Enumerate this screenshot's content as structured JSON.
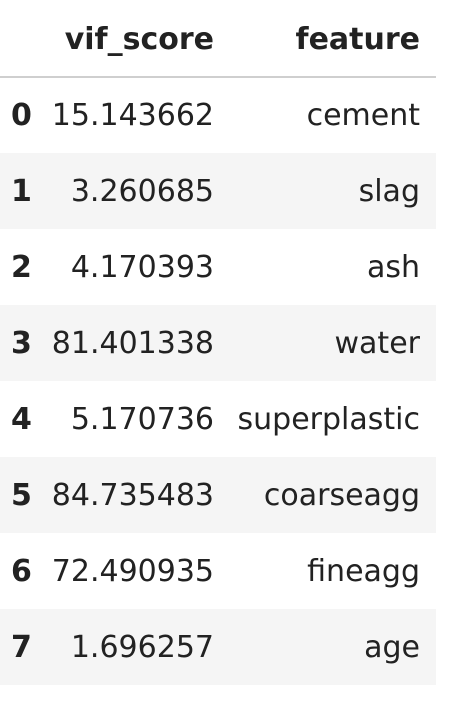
{
  "table": {
    "columns": {
      "index": "",
      "vif_score": "vif_score",
      "feature": "feature"
    },
    "rows": [
      {
        "index": "0",
        "vif_score": "15.143662",
        "feature": "cement"
      },
      {
        "index": "1",
        "vif_score": "3.260685",
        "feature": "slag"
      },
      {
        "index": "2",
        "vif_score": "4.170393",
        "feature": "ash"
      },
      {
        "index": "3",
        "vif_score": "81.401338",
        "feature": "water"
      },
      {
        "index": "4",
        "vif_score": "5.170736",
        "feature": "superplastic"
      },
      {
        "index": "5",
        "vif_score": "84.735483",
        "feature": "coarseagg"
      },
      {
        "index": "6",
        "vif_score": "72.490935",
        "feature": "fineagg"
      },
      {
        "index": "7",
        "vif_score": "1.696257",
        "feature": "age"
      }
    ]
  }
}
